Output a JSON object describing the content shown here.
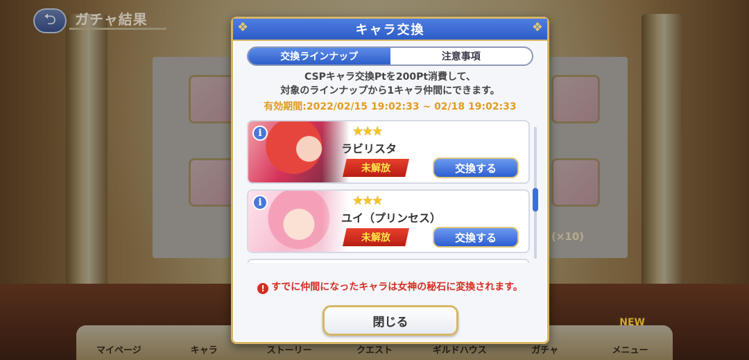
{
  "header": {
    "title": "ガチャ結果"
  },
  "background": {
    "count_label": "(×10)"
  },
  "bottom_nav": {
    "items": [
      "マイページ",
      "キャラ",
      "ストーリー",
      "クエスト",
      "ギルドハウス",
      "ガチャ",
      "メニュー"
    ],
    "new_badge": "NEW"
  },
  "dialog": {
    "title": "キャラ交換",
    "tabs": [
      {
        "label": "交換ラインナップ",
        "active": true
      },
      {
        "label": "注意事項",
        "active": false
      }
    ],
    "description_line1": "CSPキャラ交換Ptを200Pt消費して、",
    "description_line2": "対象のラインナップから1キャラ仲間にできます。",
    "period": "有効期間:2022/02/15 19:02:33 ~ 02/18 19:02:33",
    "characters": [
      {
        "name": "ラビリスタ",
        "stars": "★★★",
        "status": "未解放",
        "button": "交換する",
        "info": "i"
      },
      {
        "name": "ユイ（プリンセス）",
        "stars": "★★★",
        "status": "未解放",
        "button": "交換する",
        "info": "i"
      }
    ],
    "note": "すでに仲間になったキャラは女神の秘石に変換されます。",
    "note_icon": "!",
    "close_button": "閉じる"
  },
  "colors": {
    "header_blue": "#2d5cc8",
    "gold_border": "#d6b665",
    "locked_red": "#c0251a",
    "period_orange": "#e29b1e",
    "note_red": "#d42e22"
  }
}
